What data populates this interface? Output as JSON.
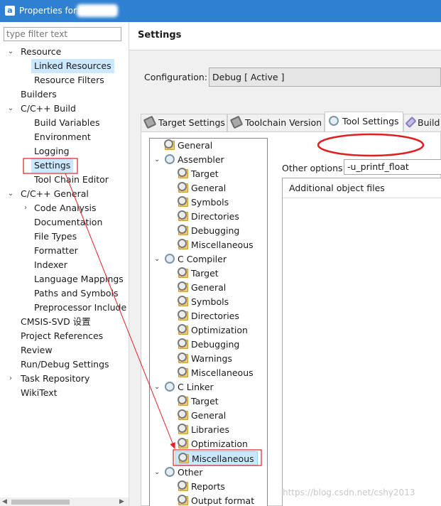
{
  "window": {
    "title": "Properties for"
  },
  "filter": {
    "placeholder": "type filter text"
  },
  "nav": {
    "resource": "Resource",
    "linked_resources": "Linked Resources",
    "resource_filters": "Resource Filters",
    "builders": "Builders",
    "cpp_build": "C/C++ Build",
    "build_variables": "Build Variables",
    "environment": "Environment",
    "logging": "Logging",
    "settings": "Settings",
    "tool_chain_editor": "Tool Chain Editor",
    "cpp_general": "C/C++ General",
    "code_analysis": "Code Analysis",
    "documentation": "Documentation",
    "file_types": "File Types",
    "formatter": "Formatter",
    "indexer": "Indexer",
    "language_mappings": "Language Mappings",
    "paths_and_symbols": "Paths and Symbols",
    "preprocessor_include": "Preprocessor Include",
    "cmsis_svd": "CMSIS-SVD 设置",
    "project_references": "Project References",
    "review": "Review",
    "run_debug_settings": "Run/Debug Settings",
    "task_repository": "Task Repository",
    "wikitext": "WikiText"
  },
  "settings": {
    "title": "Settings",
    "configuration_label": "Configuration:",
    "configuration_value": "Debug  [ Active ]"
  },
  "tabs": {
    "target_settings": "Target Settings",
    "toolchain_version": "Toolchain Version",
    "tool_settings": "Tool Settings",
    "build_steps": "Build"
  },
  "tool_tree": {
    "general": "General",
    "assembler": "Assembler",
    "asm_target": "Target",
    "asm_general": "General",
    "asm_symbols": "Symbols",
    "asm_directories": "Directories",
    "asm_debugging": "Debugging",
    "asm_misc": "Miscellaneous",
    "c_compiler": "C Compiler",
    "cc_target": "Target",
    "cc_general": "General",
    "cc_symbols": "Symbols",
    "cc_directories": "Directories",
    "cc_optimization": "Optimization",
    "cc_debugging": "Debugging",
    "cc_warnings": "Warnings",
    "cc_misc": "Miscellaneous",
    "c_linker": "C Linker",
    "ld_target": "Target",
    "ld_general": "General",
    "ld_libraries": "Libraries",
    "ld_optimization": "Optimization",
    "ld_misc": "Miscellaneous",
    "other": "Other",
    "other_reports": "Reports",
    "other_output": "Output format"
  },
  "options": {
    "other_options_label": "Other options",
    "other_options_value": "-u_printf_float",
    "additional_object_files": "Additional object files"
  },
  "watermark": "https://blog.csdn.net/cshy2013",
  "colors": {
    "titlebar": "#2f7fd3",
    "selection": "#cce8ff",
    "annotation": "#e02020"
  }
}
